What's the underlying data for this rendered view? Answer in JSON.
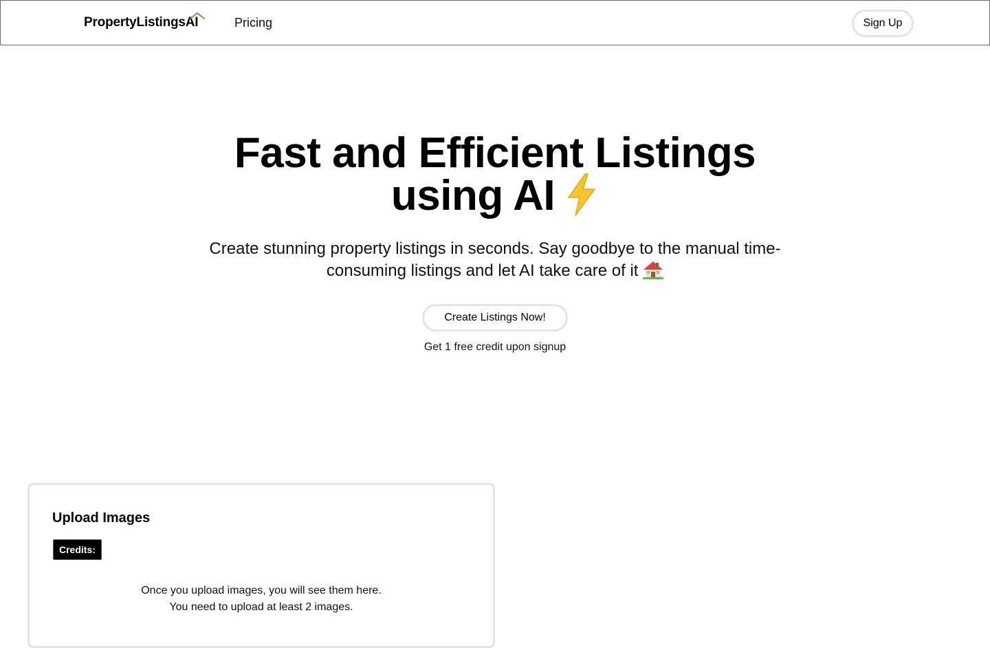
{
  "header": {
    "logo_text": "PropertyListingsAI",
    "nav_pricing": "Pricing",
    "signup_label": "Sign Up"
  },
  "hero": {
    "title_line1": "Fast and Efficient Listings",
    "title_line2": "using AI",
    "subtitle": "Create stunning property listings in seconds. Say goodbye to the manual time-consuming listings and let AI take care of it",
    "cta_label": "Create Listings Now!",
    "free_credit_note": "Get 1 free credit upon signup"
  },
  "upload": {
    "title": "Upload Images",
    "credits_label": "Credits:",
    "message_line1": "Once you upload images, you will see them here.",
    "message_line2": "You need to upload at least 2 images."
  },
  "icons": {
    "logo_roof": "roof-icon",
    "title_emoji": "lightning-bolt-icon",
    "subtitle_emoji": "house-icon"
  },
  "colors": {
    "roof": "#b5794f",
    "bolt": "#f7c52b",
    "button_border": "#e4e4e4",
    "header_border": "#6b6b6b",
    "badge_bg": "#000000"
  }
}
